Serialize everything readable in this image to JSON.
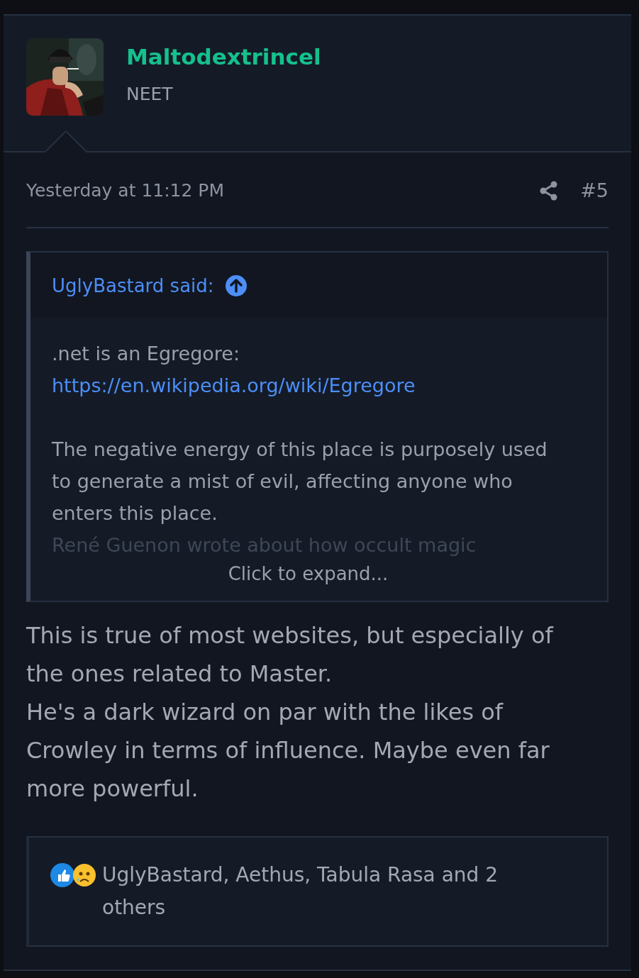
{
  "author": {
    "name": "Maltodextrincel",
    "title": "NEET"
  },
  "post": {
    "date": "Yesterday at 11:12 PM",
    "number": "#5"
  },
  "quote": {
    "attribution": "UglyBastard said:",
    "paragraphs": [
      [
        {
          "kind": "text",
          "text": ".net is an Egregore:"
        },
        {
          "kind": "link",
          "text": "https://en.wikipedia.org/wiki/Egregore"
        }
      ],
      [
        {
          "kind": "text",
          "text": "The negative energy of this place is purposely used to generate a mist of evil, affecting anyone who enters this place."
        },
        {
          "kind": "faded",
          "text": "René Guenon wrote about how occult magic"
        }
      ]
    ],
    "expand": "Click to expand..."
  },
  "body": [
    "This is true of most websites, but especially of the ones related to Master.",
    "He's a dark wizard on par with the likes of Crowley in terms of influence. Maybe even far more powerful."
  ],
  "reactions": {
    "icons": [
      {
        "kind": "like"
      },
      {
        "kind": "sad"
      }
    ],
    "text": "UglyBastard, Aethus, Tabula Rasa and 2 others"
  }
}
